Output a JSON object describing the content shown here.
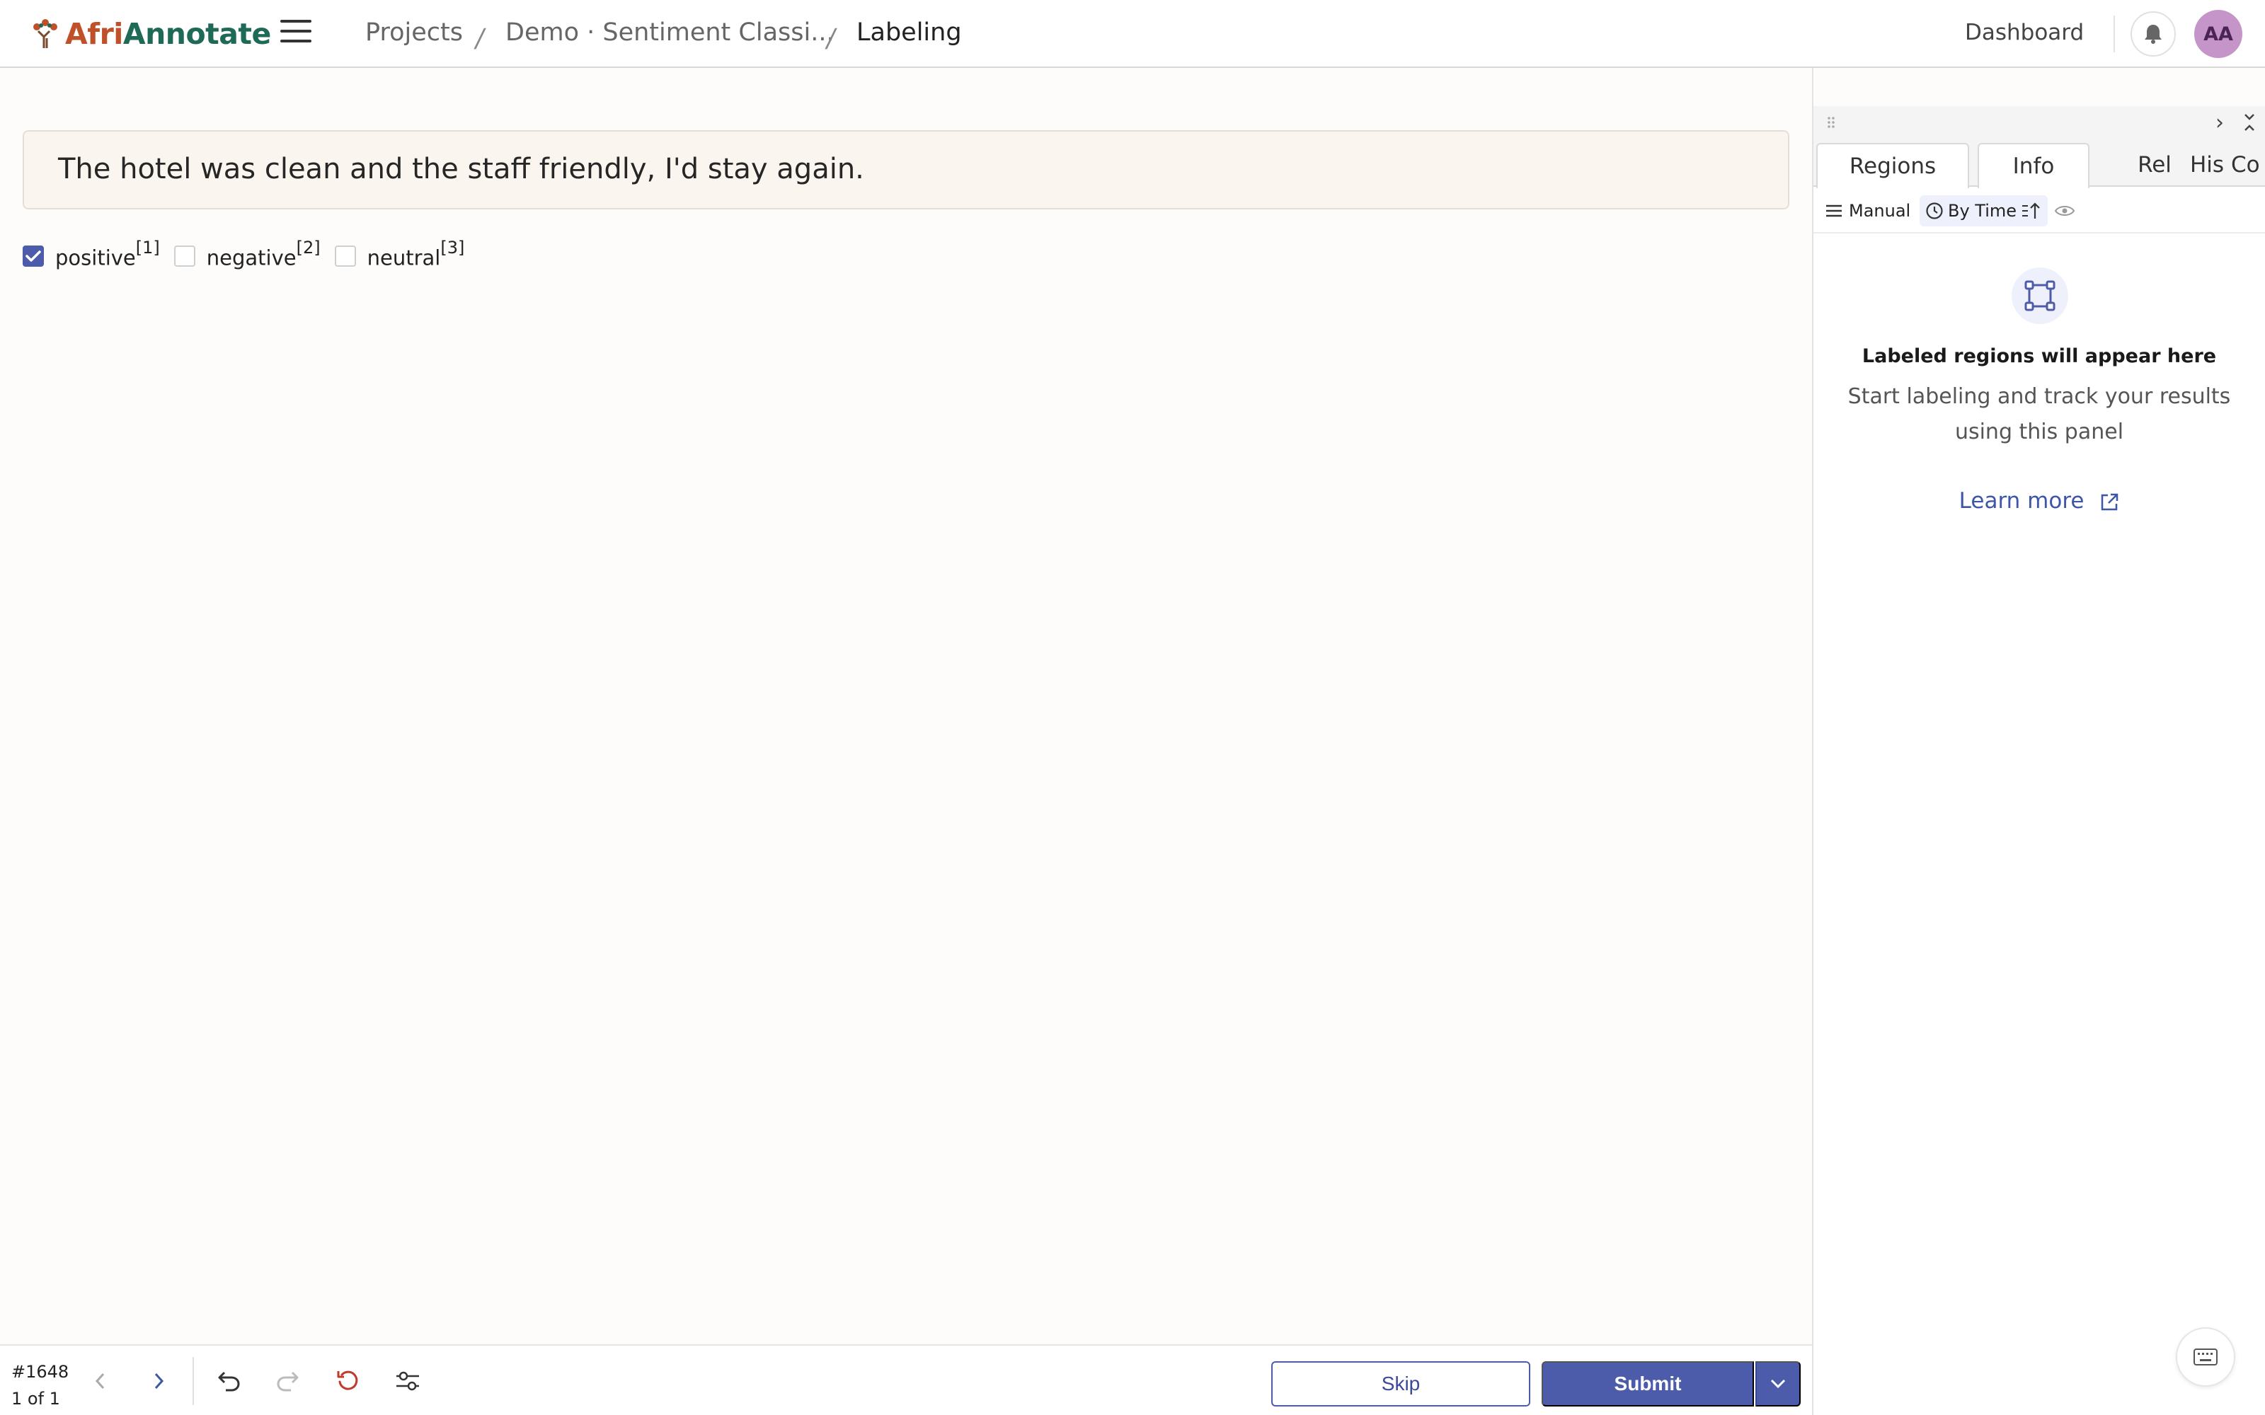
{
  "app": {
    "logo_part1": "Afri",
    "logo_part2": "Annotate"
  },
  "breadcrumbs": {
    "projects": "Projects",
    "project": "Demo · Sentiment Classi...",
    "current": "Labeling",
    "separator": "/"
  },
  "header": {
    "dashboard": "Dashboard",
    "avatar_initials": "AA",
    "icons": [
      "menu-icon",
      "bell-icon"
    ]
  },
  "task": {
    "text": "The hotel was clean and the staff friendly, I'd stay again."
  },
  "choices": [
    {
      "label": "positive",
      "hotkey": "[1]",
      "checked": true
    },
    {
      "label": "negative",
      "hotkey": "[2]",
      "checked": false
    },
    {
      "label": "neutral",
      "hotkey": "[3]",
      "checked": false
    }
  ],
  "side_panel": {
    "tabs": [
      "Regions",
      "Info",
      "Rel",
      "His",
      "Co"
    ],
    "toolbar": {
      "manual": "Manual",
      "by_time": "By Time"
    },
    "empty_title": "Labeled regions will appear here",
    "empty_subtitle": "Start labeling and track your results using this panel",
    "learn_more": "Learn more"
  },
  "footer": {
    "task_id": "#1648",
    "position": "1 of 1",
    "skip": "Skip",
    "submit": "Submit"
  },
  "colors": {
    "accent": "#4d5bab",
    "logo_orange": "#c0502a",
    "logo_green": "#1e6a56",
    "text_card_bg": "#fbf5ef",
    "avatar_bg": "#c594c8",
    "reset_red": "#c0392b"
  }
}
